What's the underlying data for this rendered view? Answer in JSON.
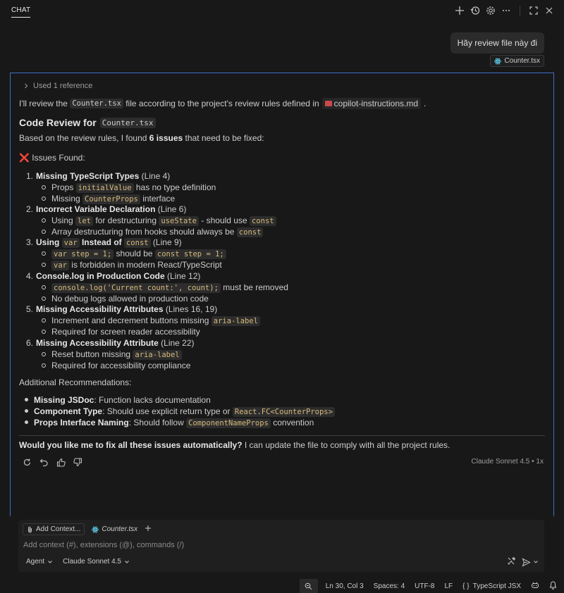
{
  "header": {
    "tab_label": "CHAT"
  },
  "user": {
    "message": "Hãy review file này đi",
    "attachment": "Counter.tsx"
  },
  "response": {
    "used_reference": "Used 1 reference",
    "intro": {
      "before": "I'll review the",
      "file": "Counter.tsx",
      "middle": "file according to the project's review rules defined in",
      "rules_file": "copilot-instructions.md",
      "after": "."
    },
    "heading": {
      "text": "Code Review for",
      "file": "Counter.tsx"
    },
    "summary": {
      "before": "Based on the review rules, I found",
      "count": "6 issues",
      "after": "that need to be fixed:"
    },
    "issues_header": {
      "icon": "❌",
      "text": "Issues Found:"
    },
    "issues": [
      {
        "num": "1.",
        "parts": [
          {
            "t": "b",
            "v": "Missing TypeScript Types"
          },
          {
            "t": "p",
            "v": " (Line 4)"
          }
        ],
        "subs": [
          [
            {
              "t": "p",
              "v": "Props "
            },
            {
              "t": "c",
              "v": "initialValue"
            },
            {
              "t": "p",
              "v": " has no type definition"
            }
          ],
          [
            {
              "t": "p",
              "v": "Missing "
            },
            {
              "t": "c",
              "v": "CounterProps"
            },
            {
              "t": "p",
              "v": " interface"
            }
          ]
        ]
      },
      {
        "num": "2.",
        "parts": [
          {
            "t": "b",
            "v": "Incorrect Variable Declaration"
          },
          {
            "t": "p",
            "v": " (Line 6)"
          }
        ],
        "subs": [
          [
            {
              "t": "p",
              "v": "Using "
            },
            {
              "t": "c",
              "v": "let"
            },
            {
              "t": "p",
              "v": " for destructuring "
            },
            {
              "t": "c",
              "v": "useState"
            },
            {
              "t": "p",
              "v": " - should use "
            },
            {
              "t": "c",
              "v": "const"
            }
          ],
          [
            {
              "t": "p",
              "v": "Array destructuring from hooks should always be "
            },
            {
              "t": "c",
              "v": "const"
            }
          ]
        ]
      },
      {
        "num": "3.",
        "parts": [
          {
            "t": "b",
            "v": "Using "
          },
          {
            "t": "c",
            "v": "var"
          },
          {
            "t": "b",
            "v": " Instead of "
          },
          {
            "t": "c",
            "v": "const"
          },
          {
            "t": "p",
            "v": " (Line 9)"
          }
        ],
        "subs": [
          [
            {
              "t": "c",
              "v": "var step = 1;"
            },
            {
              "t": "p",
              "v": " should be "
            },
            {
              "t": "c",
              "v": "const step = 1;"
            }
          ],
          [
            {
              "t": "c",
              "v": "var"
            },
            {
              "t": "p",
              "v": " is forbidden in modern React/TypeScript"
            }
          ]
        ]
      },
      {
        "num": "4.",
        "parts": [
          {
            "t": "b",
            "v": "Console.log in Production Code"
          },
          {
            "t": "p",
            "v": " (Line 12)"
          }
        ],
        "subs": [
          [
            {
              "t": "c",
              "v": "console.log('Current count:', count);"
            },
            {
              "t": "p",
              "v": " must be removed"
            }
          ],
          [
            {
              "t": "p",
              "v": "No debug logs allowed in production code"
            }
          ]
        ]
      },
      {
        "num": "5.",
        "parts": [
          {
            "t": "b",
            "v": "Missing Accessibility Attributes"
          },
          {
            "t": "p",
            "v": " (Lines 16, 19)"
          }
        ],
        "subs": [
          [
            {
              "t": "p",
              "v": "Increment and decrement buttons missing "
            },
            {
              "t": "c",
              "v": "aria-label"
            }
          ],
          [
            {
              "t": "p",
              "v": "Required for screen reader accessibility"
            }
          ]
        ]
      },
      {
        "num": "6.",
        "parts": [
          {
            "t": "b",
            "v": "Missing Accessibility Attribute"
          },
          {
            "t": "p",
            "v": " (Line 22)"
          }
        ],
        "subs": [
          [
            {
              "t": "p",
              "v": "Reset button missing "
            },
            {
              "t": "c",
              "v": "aria-label"
            }
          ],
          [
            {
              "t": "p",
              "v": "Required for accessibility compliance"
            }
          ]
        ]
      }
    ],
    "additional_header": "Additional Recommendations:",
    "recommendations": [
      [
        {
          "t": "b",
          "v": "Missing JSDoc"
        },
        {
          "t": "p",
          "v": ": Function lacks documentation"
        }
      ],
      [
        {
          "t": "b",
          "v": "Component Type"
        },
        {
          "t": "p",
          "v": ": Should use explicit return type or "
        },
        {
          "t": "c",
          "v": "React.FC<CounterProps>"
        }
      ],
      [
        {
          "t": "b",
          "v": "Props Interface Naming"
        },
        {
          "t": "p",
          "v": ": Should follow "
        },
        {
          "t": "c",
          "v": "ComponentNameProps"
        },
        {
          "t": "p",
          "v": " convention"
        }
      ]
    ],
    "closing": {
      "question": "Would you like me to fix all these issues automatically?",
      "rest": " I can update the file to comply with all the project rules."
    },
    "model_note": "Claude Sonnet 4.5 • 1x"
  },
  "input": {
    "add_context": "Add Context...",
    "file": "Counter.tsx",
    "placeholder": "Add context (#), extensions (@), commands (/)",
    "mode": "Agent",
    "model": "Claude Sonnet 4.5"
  },
  "status": {
    "position": "Ln 30, Col 3",
    "spaces": "Spaces: 4",
    "encoding": "UTF-8",
    "eol": "LF",
    "language": "TypeScript JSX"
  },
  "colors": {
    "accent_border": "#3f6fc7",
    "code_text": "#d7ba7d",
    "error": "#e05252"
  }
}
